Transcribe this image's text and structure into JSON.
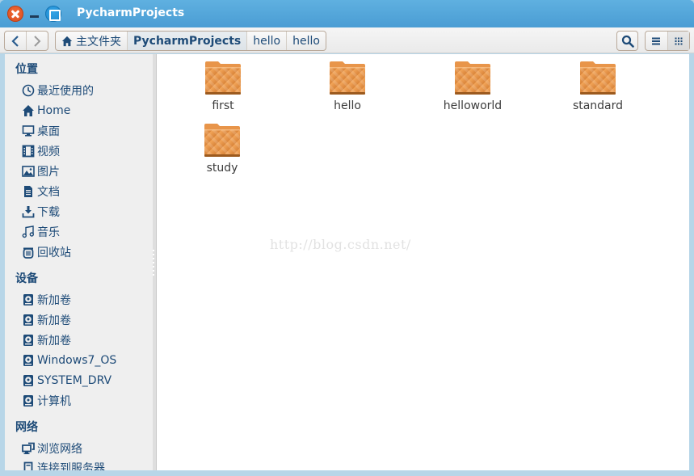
{
  "window": {
    "title": "PycharmProjects",
    "buttons": {
      "close": "close-icon",
      "minimize": "minimize-icon",
      "maximize": "maximize-icon"
    }
  },
  "toolbar": {
    "back_icon": "‹",
    "forward_icon": "›",
    "breadcrumbs": [
      {
        "label": "主文件夹",
        "icon": "home-icon"
      },
      {
        "label": "PycharmProjects",
        "active": true
      },
      {
        "label": "hello"
      },
      {
        "label": "hello"
      }
    ],
    "search_icon": "search-icon",
    "view_list_icon": "list-view-icon",
    "view_grid_icon": "grid-view-icon"
  },
  "sidebar": {
    "sections": [
      {
        "title": "位置",
        "items": [
          {
            "label": "最近使用的",
            "icon": "clock-icon"
          },
          {
            "label": "Home",
            "icon": "home-icon"
          },
          {
            "label": "桌面",
            "icon": "desktop-icon"
          },
          {
            "label": "视频",
            "icon": "film-icon"
          },
          {
            "label": "图片",
            "icon": "picture-icon"
          },
          {
            "label": "文档",
            "icon": "document-icon"
          },
          {
            "label": "下载",
            "icon": "download-icon"
          },
          {
            "label": "音乐",
            "icon": "music-icon"
          },
          {
            "label": "回收站",
            "icon": "trash-icon"
          }
        ]
      },
      {
        "title": "设备",
        "items": [
          {
            "label": "新加卷",
            "icon": "drive-icon"
          },
          {
            "label": "新加卷",
            "icon": "drive-icon"
          },
          {
            "label": "新加卷",
            "icon": "drive-icon"
          },
          {
            "label": "Windows7_OS",
            "icon": "drive-icon"
          },
          {
            "label": "SYSTEM_DRV",
            "icon": "drive-icon"
          },
          {
            "label": "计算机",
            "icon": "drive-icon"
          }
        ]
      },
      {
        "title": "网络",
        "items": [
          {
            "label": "浏览网络",
            "icon": "network-icon"
          },
          {
            "label": "连接到服务器",
            "icon": "server-icon"
          }
        ]
      }
    ]
  },
  "content": {
    "folders": [
      {
        "name": "first"
      },
      {
        "name": "hello"
      },
      {
        "name": "helloworld"
      },
      {
        "name": "standard"
      },
      {
        "name": "study"
      }
    ],
    "watermark": "http://blog.csdn.net/"
  },
  "colors": {
    "titlebar": "#4e9fd3",
    "accent_text": "#1e4b78",
    "folder": "#e8954a"
  }
}
